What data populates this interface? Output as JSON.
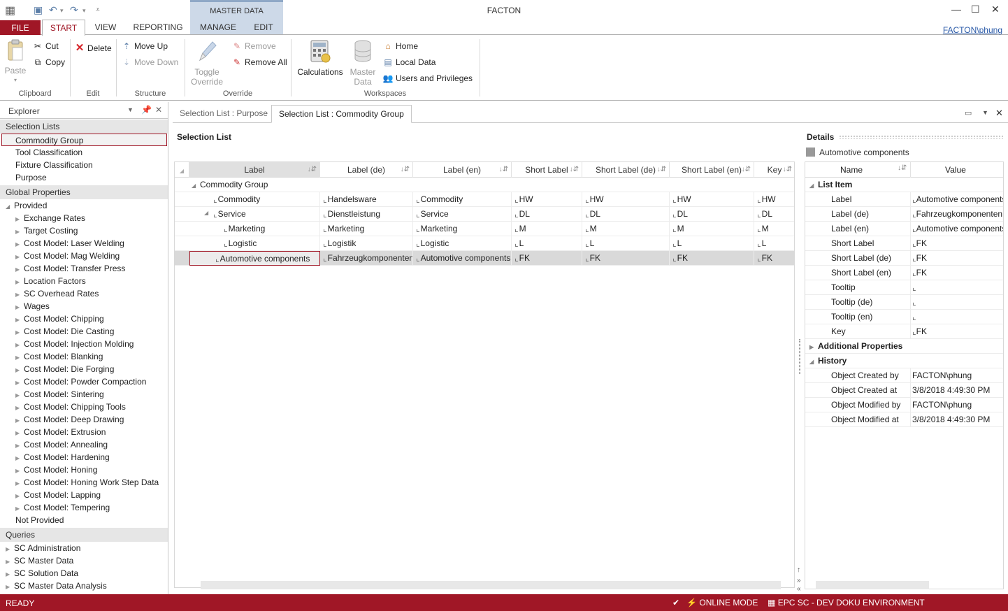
{
  "app": {
    "title": "FACTON",
    "user": "FACTON\\phung",
    "contextual_group": "MASTER DATA"
  },
  "ribbon": {
    "tabs": {
      "file": "FILE",
      "start": "START",
      "view": "VIEW",
      "reporting": "REPORTING",
      "manage": "MANAGE",
      "edit": "EDIT"
    },
    "clipboard": {
      "label": "Clipboard",
      "paste": "Paste",
      "cut": "Cut",
      "copy": "Copy"
    },
    "edit": {
      "label": "Edit",
      "delete": "Delete"
    },
    "structure": {
      "label": "Structure",
      "move_up": "Move Up",
      "move_down": "Move Down"
    },
    "override": {
      "label": "Override",
      "toggle_line1": "Toggle",
      "toggle_line2": "Override",
      "remove": "Remove",
      "remove_all": "Remove All"
    },
    "workspaces": {
      "label": "Workspaces",
      "calculations": "Calculations",
      "master_line1": "Master",
      "master_line2": "Data",
      "home": "Home",
      "local_data": "Local Data",
      "users": "Users and Privileges"
    }
  },
  "explorer": {
    "title": "Explorer",
    "sections": {
      "selection_lists": "Selection Lists",
      "global_properties": "Global Properties",
      "queries": "Queries"
    },
    "selection_lists": [
      "Commodity Group",
      "Tool Classification",
      "Fixture Classification",
      "Purpose"
    ],
    "provided_label": "Provided",
    "provided": [
      "Exchange Rates",
      "Target Costing",
      "Cost Model: Laser Welding",
      "Cost Model: Mag Welding",
      "Cost Model: Transfer Press",
      "Location Factors",
      "SC Overhead Rates",
      "Wages",
      "Cost Model: Chipping",
      "Cost Model: Die Casting",
      "Cost Model: Injection Molding",
      "Cost Model: Blanking",
      "Cost Model: Die Forging",
      "Cost Model: Powder Compaction",
      "Cost Model: Sintering",
      "Cost Model: Chipping Tools",
      "Cost Model: Deep Drawing",
      "Cost Model: Extrusion",
      "Cost Model: Annealing",
      "Cost Model: Hardening",
      "Cost Model: Honing",
      "Cost Model: Honing Work Step Data",
      "Cost Model: Lapping",
      "Cost Model: Tempering"
    ],
    "not_provided": "Not Provided",
    "queries": [
      "SC Administration",
      "SC Master Data",
      "SC Solution Data",
      "SC Master Data Analysis"
    ]
  },
  "doc_tabs": [
    "Selection List : Purpose",
    "Selection List : Commodity Group"
  ],
  "selection_list": {
    "title": "Selection List",
    "columns": [
      "Label",
      "Label (de)",
      "Label (en)",
      "Short Label",
      "Short Label (de)",
      "Short Label (en)",
      "Key"
    ],
    "group_label": "Commodity Group",
    "rows": [
      [
        "Commodity",
        "Handelsware",
        "Commodity",
        "HW",
        "HW",
        "HW",
        "HW"
      ],
      [
        "Service",
        "Dienstleistung",
        "Service",
        "DL",
        "DL",
        "DL",
        "DL"
      ],
      [
        "Marketing",
        "Marketing",
        "Marketing",
        "M",
        "M",
        "M",
        "M"
      ],
      [
        "Logistic",
        "Logistik",
        "Logistic",
        "L",
        "L",
        "L",
        "L"
      ],
      [
        "Automotive components",
        "Fahrzeugkomponenten",
        "Automotive components",
        "FK",
        "FK",
        "FK",
        "FK"
      ]
    ]
  },
  "details": {
    "title": "Details",
    "object": "Automotive components",
    "columns": [
      "Name",
      "Value"
    ],
    "categories": {
      "list_item": "List Item",
      "additional": "Additional Properties",
      "history": "History"
    },
    "list_item": [
      [
        "Label",
        "Automotive components"
      ],
      [
        "Label (de)",
        "Fahrzeugkomponenten"
      ],
      [
        "Label (en)",
        "Automotive components"
      ],
      [
        "Short Label",
        "FK"
      ],
      [
        "Short Label (de)",
        "FK"
      ],
      [
        "Short Label (en)",
        "FK"
      ],
      [
        "Tooltip",
        ""
      ],
      [
        "Tooltip (de)",
        ""
      ],
      [
        "Tooltip (en)",
        ""
      ],
      [
        "Key",
        "FK"
      ]
    ],
    "history": [
      [
        "Object Created by",
        "FACTON\\phung"
      ],
      [
        "Object Created at",
        "3/8/2018 4:49:30 PM"
      ],
      [
        "Object Modified by",
        "FACTON\\phung"
      ],
      [
        "Object Modified at",
        "3/8/2018 4:49:30 PM"
      ]
    ]
  },
  "status": {
    "ready": "READY",
    "mode": "ONLINE MODE",
    "environment": "EPC SC - DEV DOKU ENVIRONMENT"
  }
}
